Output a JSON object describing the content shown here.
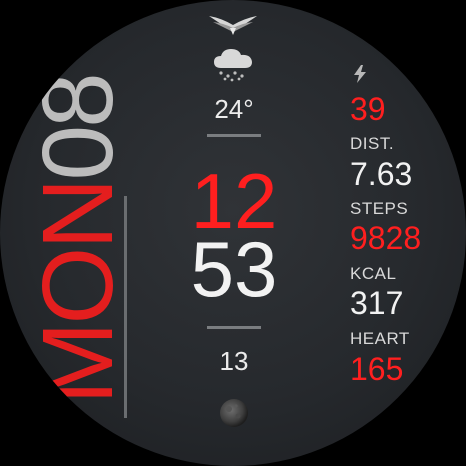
{
  "date": {
    "day": "MON",
    "day_num": "08"
  },
  "weather": {
    "icon": "cloud-snow-icon",
    "temperature": "24°"
  },
  "time": {
    "hour": "12",
    "minute": "53",
    "second": "13"
  },
  "stats": {
    "battery_value": "39",
    "dist_label": "DIST.",
    "dist_value": "7.63",
    "steps_label": "STEPS",
    "steps_value": "9828",
    "kcal_label": "KCAL",
    "kcal_value": "317",
    "heart_label": "HEART",
    "heart_value": "165"
  },
  "colors": {
    "accent": "#ff1f1f",
    "text": "#f2f2f2",
    "background": "#26292d"
  }
}
